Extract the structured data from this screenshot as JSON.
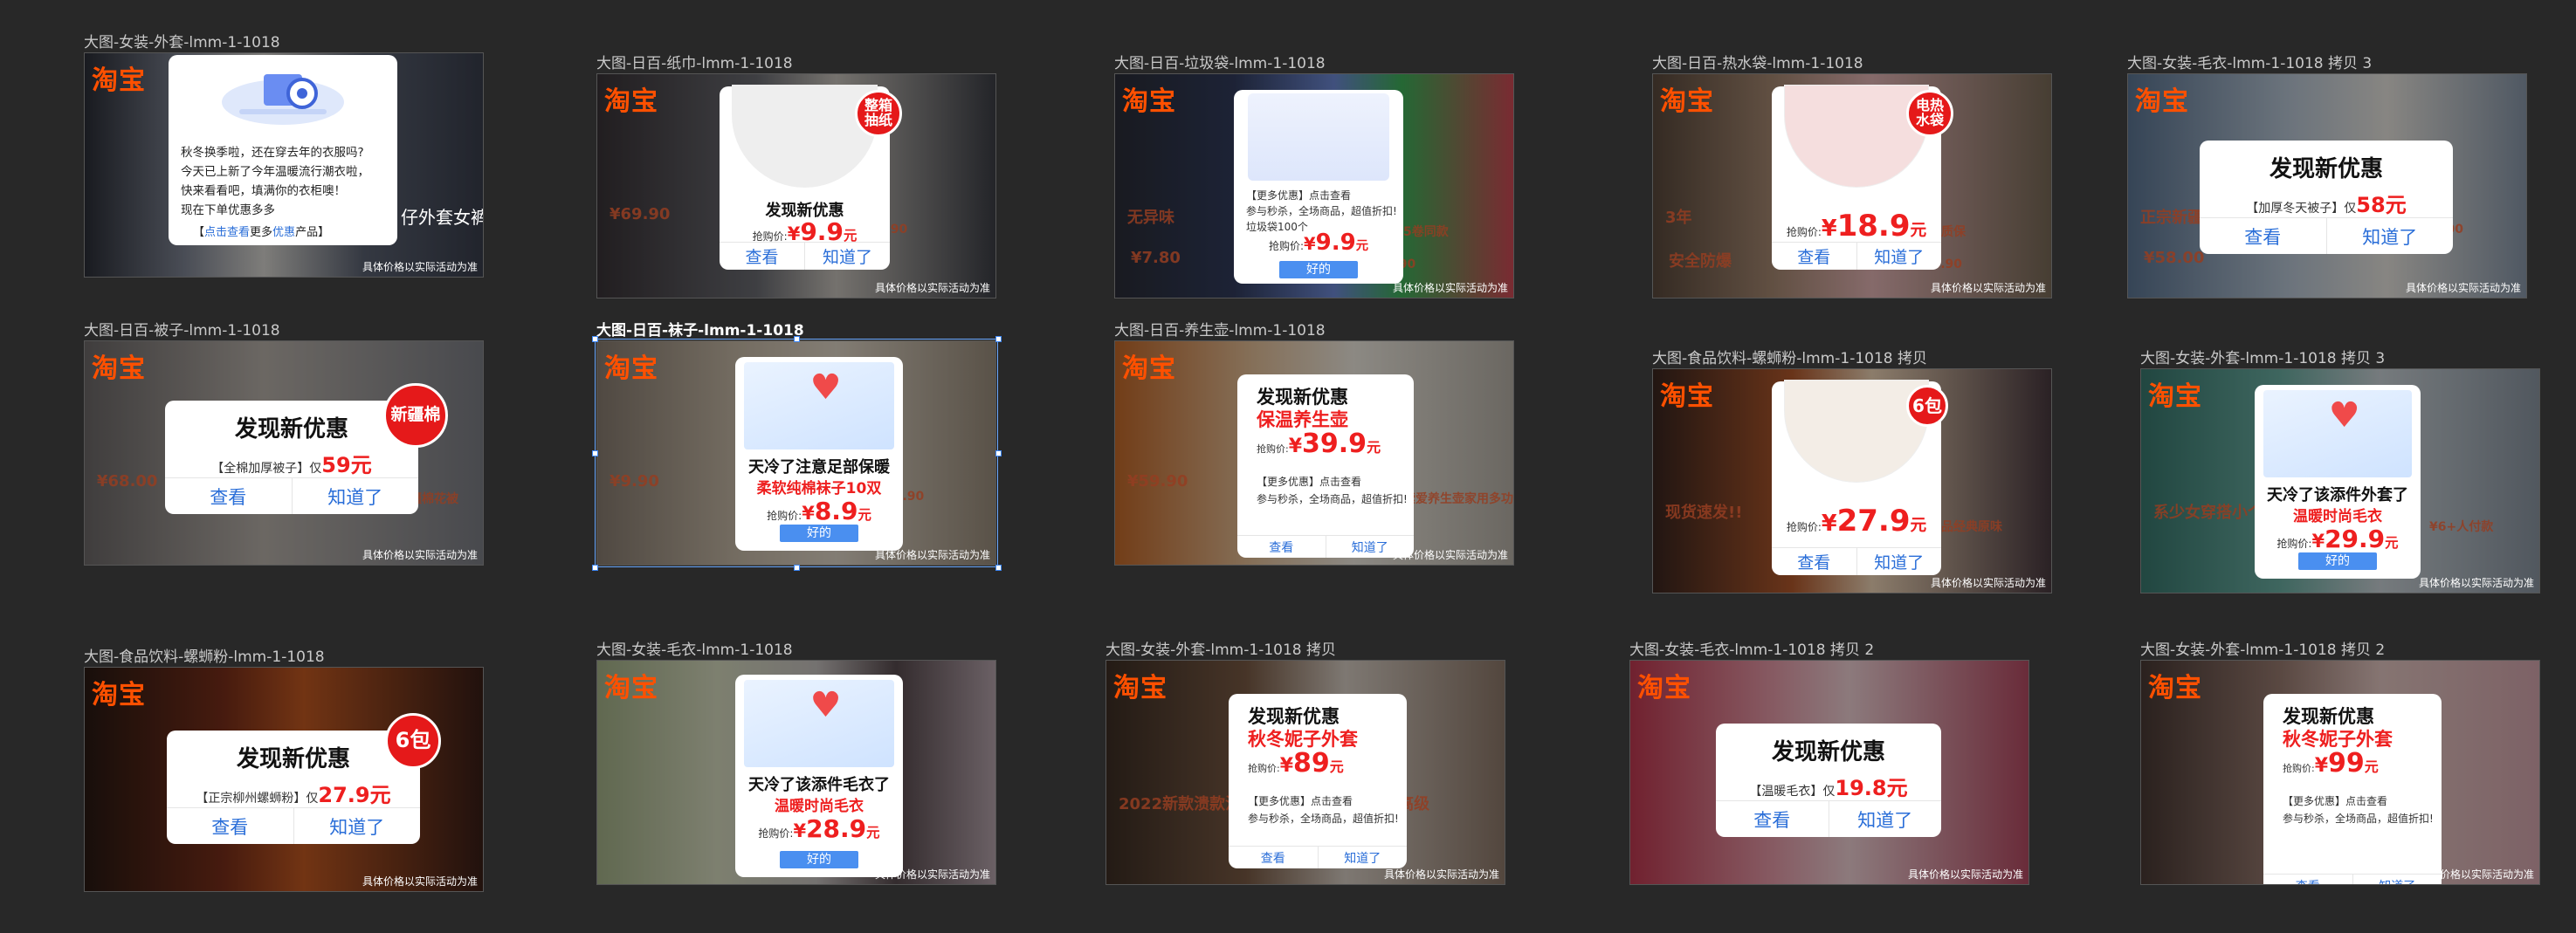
{
  "artboards": [
    {
      "label": "大图-女装-外套-lmm-1-1018",
      "bg": "linear-gradient(90deg,#2c2f38 0%,#7f8594 25%,#d9d7d2 45%,#5b6272 70%,#3a3f4d 100%)",
      "text_lines": [
        "秋冬换季啦，还在穿去年的衣服吗?",
        "今天已上新了今年温暖流行潮衣啦，",
        "快来看看吧，填满你的衣柜噢！",
        "现在下单优惠多多"
      ],
      "link": {
        "pre": "【",
        "a": "点击查看",
        "b": "更多",
        "c": "优惠",
        "d": "产品】"
      },
      "caption": "仔外套女裤"
    },
    {
      "label": "大图-日百-纸巾-lmm-1-1018",
      "bg": "linear-gradient(90deg,#3a3438 0%,#6c6d73 40%,#c9c4bd 60%,#3e4047 100%)",
      "title": "发现新优惠",
      "price_label": "抢购价:",
      "currency": "¥",
      "price": "9.9",
      "unit": "元",
      "badge": "整箱\n抽纸",
      "btn_left": "查看",
      "btn_right": "知道了",
      "bg_texts": [
        "¥69.90",
        "-90"
      ]
    },
    {
      "label": "大图-日百-垃圾袋-lmm-1-1018",
      "bg": "linear-gradient(90deg,#2b2e38 0%,#323c5d 30%,#6f8bd8 55%,#40b35a 72%,#d24a56 100%)",
      "lines": [
        "【更多优惠】点击查看",
        "参与秒杀，全场商品，超值折扣!",
        "垃圾袋100个"
      ],
      "price_label": "抢购价:",
      "currency": "¥",
      "price": "9.9",
      "unit": "元",
      "ok": "好的",
      "bg_texts": [
        "无异味",
        "5卷同款",
        "¥7.80",
        "¥9.90"
      ]
    },
    {
      "label": "大图-日百-热水袋-lmm-1-1018",
      "bg": "linear-gradient(90deg,#5b4a3d 0%,#a88a73 30%,#e6b7b7 55%,#7a6b58 100%)",
      "badge": "电热\n水袋",
      "price_label": "抢购价:",
      "currency": "¥",
      "price": "18.9",
      "unit": "元",
      "btn_left": "查看",
      "btn_right": "知道了",
      "bg_texts": [
        "3年",
        "质保",
        "安全防爆",
        "¥38.90"
      ]
    },
    {
      "label": "大图-女装-毛衣-lmm-1-1018 拷贝 3",
      "bg": "linear-gradient(90deg,#5d7795 0%,#b9c7d6 40%,#e9e6e0 65%,#8a99ab 100%)",
      "title": "发现新优惠",
      "sub": "【加厚冬天被子】仅",
      "price": "58元",
      "btn_left": "查看",
      "btn_right": "知道了",
      "bg_texts": [
        "正宗新疆棉花被",
        "¥69.00",
        "¥58.00"
      ]
    },
    {
      "label": "大图-日百-被子-lmm-1-1018",
      "bg": "linear-gradient(90deg,#6e6a6a 0%,#b9b2ab 45%,#7d7f86 100%)",
      "title": "发现新优惠",
      "sub": "【全棉加厚被子】仅",
      "price": "59元",
      "badge": "新疆棉",
      "btn_left": "查看",
      "btn_right": "知道了",
      "bg_texts": [
        "¥68.00",
        "正宗新疆棉花被"
      ]
    },
    {
      "label": "大图-日百-袜子-lmm-1-1018",
      "bg": "linear-gradient(90deg,#8a7e72 0%,#c8bba8 35%,#e1d7c8 60%,#9b8e7d 100%)",
      "line1": "天冷了注意足部保暖",
      "line2": "柔软纯棉袜子10双",
      "price_label": "抢购价:",
      "currency": "¥",
      "price": "8.9",
      "unit": "元",
      "ok": "好的",
      "bg_texts": [
        "¥9.90",
        "¥8.90"
      ]
    },
    {
      "label": "大图-日百-养生壶-lmm-1-1018",
      "bg": "linear-gradient(90deg,#c56a2a 0%,#e6c29b 35%,#f1ece2 60%,#b8b2a8 100%)",
      "title": "发现新优惠",
      "red": "保温养生壶",
      "price_label": "抢购价:",
      "currency": "¥",
      "price": "39.9",
      "unit": "元",
      "lines": [
        "【更多优惠】点击查看",
        "参与秒杀，全场商品，超值折扣!"
      ],
      "btn_left": "查看",
      "btn_right": "知道了",
      "bg_texts": [
        "¥59.90",
        "索爱养生壶家用多功能煮茶器办公室"
      ]
    },
    {
      "label": "大图-食品饮料-螺蛳粉-lmm-1-1018 拷贝",
      "bg": "linear-gradient(90deg,#3b2620 0%,#b55a2c 35%,#f0d6b8 55%,#4a3a40 100%)",
      "badge": "6包",
      "price_label": "抢购价:",
      "currency": "¥",
      "price": "27.9",
      "unit": "元",
      "btn_left": "查看",
      "btn_right": "知道了",
      "bg_texts": [
        "现货速发!!",
        "品经典原味"
      ]
    },
    {
      "label": "大图-女装-外套-lmm-1-1018 拷贝 3",
      "bg": "linear-gradient(90deg,#3a7a70 0%,#6cb0a4 35%,#cbd3d8 60%,#8c97a3 100%)",
      "line1": "天冷了该添件外套了",
      "line2": "温暖时尚毛衣",
      "price_label": "抢购价:",
      "currency": "¥",
      "price": "29.9",
      "unit": "元",
      "ok": "好的",
      "bg_texts": [
        "系少女穿搭小个",
        "¥6+人付款"
      ]
    },
    {
      "label": "大图-食品饮料-螺蛳粉-lmm-1-1018",
      "bg": "linear-gradient(90deg,#2a1a14 0%,#7a2f1a 35%,#c45a22 55%,#3a1e18 100%)",
      "title": "发现新优惠",
      "sub": "【正宗柳州螺蛳粉】仅",
      "price": "27.9元",
      "badge": "6包",
      "btn_left": "查看",
      "btn_right": "知道了",
      "bg_texts": []
    },
    {
      "label": "大图-女装-毛衣-lmm-1-1018",
      "bg": "linear-gradient(90deg,#a6b48a 0%,#d8dcc0 30%,#c9c4c2 55%,#5a4c50 75%,#b8a6ae 100%)",
      "line1": "天冷了该添件毛衣了",
      "line2": "温暖时尚毛衣",
      "price_label": "抢购价:",
      "currency": "¥",
      "price": "28.9",
      "unit": "元",
      "ok": "好的",
      "bg_texts": []
    },
    {
      "label": "大图-女装-外套-lmm-1-1018 拷贝",
      "bg": "linear-gradient(90deg,#3e2f25 0%,#7a5b45 35%,#d9cfc5 60%,#8f7a6b 100%)",
      "title": "发现新优惠",
      "red": "秋冬妮子外套",
      "price_label": "抢购价:",
      "currency": "¥",
      "price": "89",
      "unit": "元",
      "lines": [
        "【更多优惠】点击查看",
        "参与秒杀，全场商品，超值折扣!"
      ],
      "btn_left": "查看",
      "btn_right": "知道了",
      "bg_texts": [
        "2022新款溃款法式高领毛呢外套女秋冬高级"
      ]
    },
    {
      "label": "大图-女装-毛衣-lmm-1-1018 拷贝 2",
      "bg": "linear-gradient(90deg,#c23a52 0%,#e79aa8 35%,#f1d2d6 55%,#b64c64 100%)",
      "title": "发现新优惠",
      "sub": "【温暖毛衣】仅",
      "price": "19.8元",
      "btn_left": "查看",
      "btn_right": "知道了",
      "bg_texts": []
    },
    {
      "label": "大图-女装-外套-lmm-1-1018 拷贝 2",
      "bg": "linear-gradient(90deg,#4a3a35 0%,#9b7d72 35%,#e6c9c4 60%,#d8a9b0 100%)",
      "title": "发现新优惠",
      "red": "秋冬妮子外套",
      "price_label": "抢购价:",
      "currency": "¥",
      "price": "99",
      "unit": "元",
      "lines": [
        "【更多优惠】点击查看",
        "参与秒杀，全场商品，超值折扣!"
      ],
      "btn_left": "查看",
      "btn_right": "知道了",
      "bg_texts": []
    }
  ],
  "logo": "淘宝",
  "footer_note": "具体价格以实际活动为准"
}
